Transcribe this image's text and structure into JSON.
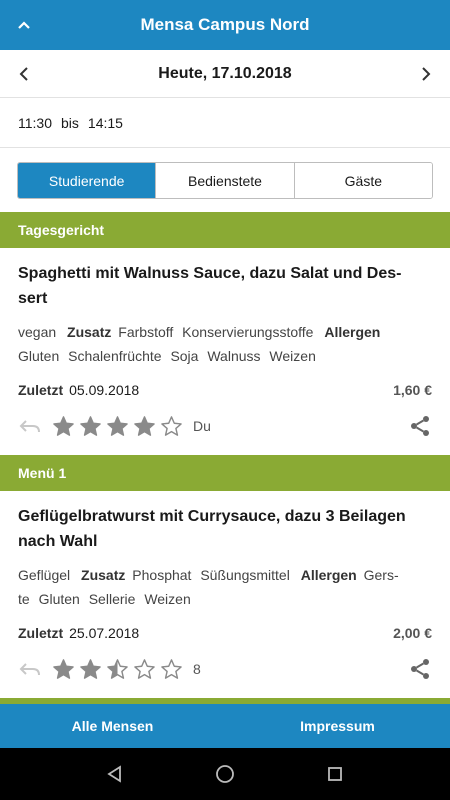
{
  "appbar": {
    "title": "Mensa Campus Nord",
    "up_icon": "chevron-up-icon"
  },
  "datebar": {
    "date": "Heute, 17.10.2018",
    "prev_icon": "chevron-left-icon",
    "next_icon": "chevron-right-icon"
  },
  "hours": {
    "open": "11:30",
    "sep": "bis",
    "close": "14:15"
  },
  "segments": [
    {
      "label": "Studierende",
      "active": true
    },
    {
      "label": "Bedienstete",
      "active": false
    },
    {
      "label": "Gäste",
      "active": false
    }
  ],
  "sections": [
    {
      "header": "Tagesgericht",
      "meal": {
        "name": "Spaghetti mit Walnuss Sauce, dazu Salat und Des-sert",
        "tags_line1": {
          "t0": "vegan",
          "zusatz_label": "Zusatz",
          "z1": "Farbstoff",
          "z2": "Konservierungsstoffe",
          "allergen_label": "Allergen"
        },
        "tags_line2": {
          "a1": "Gluten",
          "a2": "Schalenfrüchte",
          "a3": "Soja",
          "a4": "Walnuss",
          "a5": "Weizen"
        },
        "last_label": "Zuletzt",
        "last_date": "05.09.2018",
        "price": "1,60 €",
        "rating": 4,
        "rating_max": 5,
        "rating_text": "Du"
      }
    },
    {
      "header": "Menü 1",
      "meal": {
        "name": "Geflügelbratwurst mit Currysauce, dazu 3 Beilagen nach Wahl",
        "tags_line1": {
          "t0": "Geflügel",
          "zusatz_label": "Zusatz",
          "z1": "Phosphat",
          "z2": "Süßungsmittel",
          "allergen_label": "Allergen",
          "a0": "Gers-"
        },
        "tags_line2": {
          "a1": "te",
          "a2": "Gluten",
          "a3": "Sellerie",
          "a4": "Weizen"
        },
        "last_label": "Zuletzt",
        "last_date": "25.07.2018",
        "price": "2,00 €",
        "rating": 2.5,
        "rating_max": 5,
        "rating_text": "8"
      }
    }
  ],
  "bottom": {
    "left": "Alle Mensen",
    "right": "Impressum"
  },
  "sysnav": {
    "back": "back-icon",
    "home": "home-icon",
    "recents": "recents-icon"
  },
  "colors": {
    "primary": "#1d87c1",
    "section": "#8aaa34",
    "star": "#8a8a8a"
  }
}
